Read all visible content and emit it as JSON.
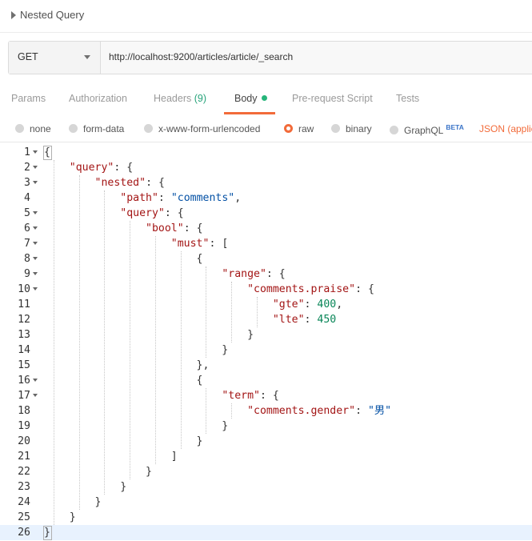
{
  "request": {
    "name": "Nested Query",
    "method": "GET",
    "url": "http://localhost:9200/articles/article/_search"
  },
  "tabs": {
    "params": "Params",
    "authorization": "Authorization",
    "headers": "Headers",
    "headers_count": "(9)",
    "body": "Body",
    "pre_request": "Pre-request Script",
    "tests": "Tests",
    "active": "Body"
  },
  "body_options": {
    "none": "none",
    "form_data": "form-data",
    "urlencoded": "x-www-form-urlencoded",
    "raw": "raw",
    "binary": "binary",
    "graphql": "GraphQL",
    "graphql_badge": "BETA",
    "selected": "raw",
    "content_type": "JSON (applic"
  },
  "colors": {
    "accent": "#f26b3a",
    "active_dot": "#26b57a",
    "json_key": "#a31515",
    "json_string": "#0451a5",
    "json_number": "#098658",
    "current_line": "#e8f2fe"
  },
  "editor": {
    "current_line": 26,
    "lines": [
      {
        "n": "1",
        "fold": true,
        "tokens": [
          [
            "p",
            "{"
          ]
        ]
      },
      {
        "n": "2",
        "fold": true,
        "tokens": [
          [
            "p",
            "    "
          ],
          [
            "k",
            "\"query\""
          ],
          [
            "p",
            ": {"
          ]
        ]
      },
      {
        "n": "3",
        "fold": true,
        "tokens": [
          [
            "p",
            "        "
          ],
          [
            "k",
            "\"nested\""
          ],
          [
            "p",
            ": {"
          ]
        ]
      },
      {
        "n": "4",
        "fold": false,
        "tokens": [
          [
            "p",
            "            "
          ],
          [
            "k",
            "\"path\""
          ],
          [
            "p",
            ": "
          ],
          [
            "s",
            "\"comments\""
          ],
          [
            "p",
            ","
          ]
        ]
      },
      {
        "n": "5",
        "fold": true,
        "tokens": [
          [
            "p",
            "            "
          ],
          [
            "k",
            "\"query\""
          ],
          [
            "p",
            ": {"
          ]
        ]
      },
      {
        "n": "6",
        "fold": true,
        "tokens": [
          [
            "p",
            "                "
          ],
          [
            "k",
            "\"bool\""
          ],
          [
            "p",
            ": {"
          ]
        ]
      },
      {
        "n": "7",
        "fold": true,
        "tokens": [
          [
            "p",
            "                    "
          ],
          [
            "k",
            "\"must\""
          ],
          [
            "p",
            ": ["
          ]
        ]
      },
      {
        "n": "8",
        "fold": true,
        "tokens": [
          [
            "p",
            "                        {"
          ]
        ]
      },
      {
        "n": "9",
        "fold": true,
        "tokens": [
          [
            "p",
            "                            "
          ],
          [
            "k",
            "\"range\""
          ],
          [
            "p",
            ": {"
          ]
        ]
      },
      {
        "n": "10",
        "fold": true,
        "tokens": [
          [
            "p",
            "                                "
          ],
          [
            "k",
            "\"comments.praise\""
          ],
          [
            "p",
            ": {"
          ]
        ]
      },
      {
        "n": "11",
        "fold": false,
        "tokens": [
          [
            "p",
            "                                    "
          ],
          [
            "k",
            "\"gte\""
          ],
          [
            "p",
            ": "
          ],
          [
            "n",
            "400"
          ],
          [
            "p",
            ","
          ]
        ]
      },
      {
        "n": "12",
        "fold": false,
        "tokens": [
          [
            "p",
            "                                    "
          ],
          [
            "k",
            "\"lte\""
          ],
          [
            "p",
            ": "
          ],
          [
            "n",
            "450"
          ]
        ]
      },
      {
        "n": "13",
        "fold": false,
        "tokens": [
          [
            "p",
            "                                }"
          ]
        ]
      },
      {
        "n": "14",
        "fold": false,
        "tokens": [
          [
            "p",
            "                            }"
          ]
        ]
      },
      {
        "n": "15",
        "fold": false,
        "tokens": [
          [
            "p",
            "                        },"
          ]
        ]
      },
      {
        "n": "16",
        "fold": true,
        "tokens": [
          [
            "p",
            "                        {"
          ]
        ]
      },
      {
        "n": "17",
        "fold": true,
        "tokens": [
          [
            "p",
            "                            "
          ],
          [
            "k",
            "\"term\""
          ],
          [
            "p",
            ": {"
          ]
        ]
      },
      {
        "n": "18",
        "fold": false,
        "tokens": [
          [
            "p",
            "                                "
          ],
          [
            "k",
            "\"comments.gender\""
          ],
          [
            "p",
            ": "
          ],
          [
            "s",
            "\"男\""
          ]
        ]
      },
      {
        "n": "19",
        "fold": false,
        "tokens": [
          [
            "p",
            "                            }"
          ]
        ]
      },
      {
        "n": "20",
        "fold": false,
        "tokens": [
          [
            "p",
            "                        }"
          ]
        ]
      },
      {
        "n": "21",
        "fold": false,
        "tokens": [
          [
            "p",
            "                    ]"
          ]
        ]
      },
      {
        "n": "22",
        "fold": false,
        "tokens": [
          [
            "p",
            "                }"
          ]
        ]
      },
      {
        "n": "23",
        "fold": false,
        "tokens": [
          [
            "p",
            "            }"
          ]
        ]
      },
      {
        "n": "24",
        "fold": false,
        "tokens": [
          [
            "p",
            "        }"
          ]
        ]
      },
      {
        "n": "25",
        "fold": false,
        "tokens": [
          [
            "p",
            "    }"
          ]
        ]
      },
      {
        "n": "26",
        "fold": false,
        "tokens": [
          [
            "p",
            "}"
          ]
        ]
      }
    ]
  }
}
